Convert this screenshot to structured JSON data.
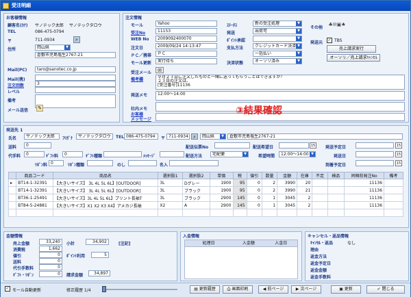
{
  "window": {
    "title": "受注明細"
  },
  "customer": {
    "section": "お客様情報",
    "name_label": "顧客名(ｶﾅ)",
    "name": "サノテック太郎",
    "kana": "サノテックタロウ",
    "tel_label": "TEL",
    "tel": "086-475-0794",
    "zip_label": "〒",
    "zip": "711-0934",
    "address_label": "住所",
    "pref": "岡山県",
    "address": "倉敷市児島塩生2767-21",
    "mail_pc_label": "Mail(PC)",
    "mail_pc": "taro@sanotec.co.jp",
    "mail_mb_label": "Mail(携)",
    "order_count_label": "注文回数",
    "order_count": "3",
    "level_label": "レベル",
    "memo_label": "備考",
    "mail_send_label": "メール送信"
  },
  "order": {
    "section": "注文情報",
    "mall_label": "モール",
    "mall": "Yahoo",
    "order_no_label": "受注No",
    "order_no": "11153",
    "web_no_label": "WEB No",
    "web_no": "2009092400070",
    "date_label": "注文日",
    "date": "2009/09/24 14:13:47",
    "pc_label": "ＰＣ／携帯",
    "pc": "ＰＣ",
    "mall_status_label": "モール更新",
    "mall_status": "実行待ち",
    "status_label": "ｽﾃｰﾀｽ",
    "status": "新の受注処理",
    "ship_label": "発送",
    "ship": "出荷可",
    "point_label": "ﾎﾟｲﾝﾄ承認",
    "pay_label": "支払方法",
    "pay": "クレジットカード決済",
    "pay2": "一括払い",
    "settle_label": "決済状態",
    "settle": "オーソリ済み",
    "other_label": "その他",
    "ship_flag_label": "発送元",
    "tbs": "TBS",
    "btn_bill": "売上請求実行",
    "btn_cancel": "オーソリ／売上請求ｷｬﾝｾﾙ",
    "mail_label": "受注メール",
    "remarks_label": "備考欄",
    "remarks": "９月２３日に注文したものと一緒に送ってもらうことはできますか？\n２３日の注文は、\n[受注番号]11136",
    "ship_remarks_label": "発送メモ",
    "ship_remarks": "12:00～14:00",
    "inner_memo_label": "社内メモ",
    "customer_msg_label": "お客様\nメッセージ"
  },
  "annotation": "③結果確認",
  "shipto": {
    "section": "発送先 1",
    "name_label": "氏名",
    "name": "サノテック太郎",
    "kana_label": "ﾌﾘｶﾞﾅ",
    "kana": "サノテックタロウ",
    "tel_label": "TEL",
    "tel": "086-475-0794",
    "zip_label": "〒",
    "zip": "711-0934",
    "pref": "岡山県",
    "address": "倉敷市児島塩生2767-21",
    "postage_label": "送料",
    "postage": "0",
    "slipno_label": "配送伝票No",
    "wishdate_label": "配送希望日",
    "planned_label": "発送予定日",
    "cod_label": "代手料",
    "cod": "0",
    "gift_label": "ｷﾞﾌﾄ料",
    "gift": "0",
    "giftkind_label": "ｷﾞﾌﾄ種類",
    "message_label": "ﾒｯｾｰｼﾞ",
    "method_label": "配送方法",
    "method": "宅配便",
    "time_label": "希望時間",
    "time": "12:00～14:00",
    "shipdate_label": "発送日",
    "ribbon_label": "ﾘﾎﾞﾝ料",
    "ribbon": "0",
    "ribbonkind_label": "ﾘﾎﾞﾝ種類",
    "noshi_label": "のし",
    "name2_label": "名入",
    "arrival_label": "到着予定日",
    "cal_icon": "15"
  },
  "items": {
    "headers": [
      "商品コード",
      "商品名",
      "選択肢1",
      "選択肢2",
      "単価",
      "税",
      "値引",
      "数量",
      "金額",
      "在庫",
      "不足",
      "検品",
      "同梱前発注No",
      "備考"
    ],
    "rows": [
      [
        "BT14-1-32391",
        "【大きいサイズ】 3L 4L 5L 6L】[OUTDOOR]",
        "3L",
        "Dグレー",
        "1900",
        "95",
        "0",
        "2",
        "3990",
        "20",
        "",
        "",
        "11136",
        ""
      ],
      [
        "BT14-1-32391",
        "【大きいサイズ】 3L 4L 5L 6L】[OUTDOOR]",
        "3L",
        "ブラック",
        "1900",
        "95",
        "0",
        "2",
        "3990",
        "21",
        "",
        "",
        "11136",
        ""
      ],
      [
        "BT36-1-25491",
        "【大きいサイズ】3L 4L 5L 6L】プリント長袖T",
        "3L",
        "ブラック",
        "2900",
        "145",
        "0",
        "1",
        "3045",
        "2",
        "",
        "",
        "11136",
        ""
      ],
      [
        "BT84-5-24881",
        "【大きいサイズ】X1 X2 X3 X4】アメカジ長袖",
        "X2",
        "A",
        "2900",
        "145",
        "0",
        "1",
        "3045",
        "2",
        "",
        "",
        "11136",
        ""
      ]
    ]
  },
  "amount": {
    "section": "金額情報",
    "sales_label": "売上金額",
    "sales": "33,240",
    "subtotal_label": "小計",
    "subtotal": "34,902",
    "note_label": "[注記]",
    "tax_label": "消費税",
    "tax": "1,662",
    "discount_label": "値引",
    "discount": "0",
    "point_label": "ﾎﾟｲﾝﾄ利用",
    "point": "5",
    "postage_label": "送料",
    "postage": "0",
    "cod_label": "代引手数料",
    "cod": "0",
    "gift_label": "ｷﾞﾌﾄ・ﾘﾎﾞﾝ",
    "gift": "0",
    "bill_label": "請求金額",
    "bill": "34,897"
  },
  "deposit": {
    "section": "入金情報",
    "headers": [
      "処理日",
      "入金額",
      "入金日"
    ]
  },
  "cancel": {
    "section": "キャンセル・返品情報",
    "kind_label": "ｷｬﾝｾﾙ・返品",
    "kind": "なし",
    "reason_label": "理由",
    "method_label": "返金方法",
    "date_label": "返金予定日",
    "amount_label": "返金金額",
    "commission_label": "返金手数料"
  },
  "footer": {
    "auto_update": "モール自動更新",
    "history": "修正履歴 1/4",
    "btn_history": "更新履歴",
    "btn_print": "画面印刷",
    "btn_prev": "前ページ",
    "btn_next": "次ページ",
    "btn_update": "更新",
    "btn_close": "閉じる"
  },
  "colors": {
    "title": "#0a5bd8",
    "annotation": "#e02020",
    "section": "#1d3b8a"
  }
}
